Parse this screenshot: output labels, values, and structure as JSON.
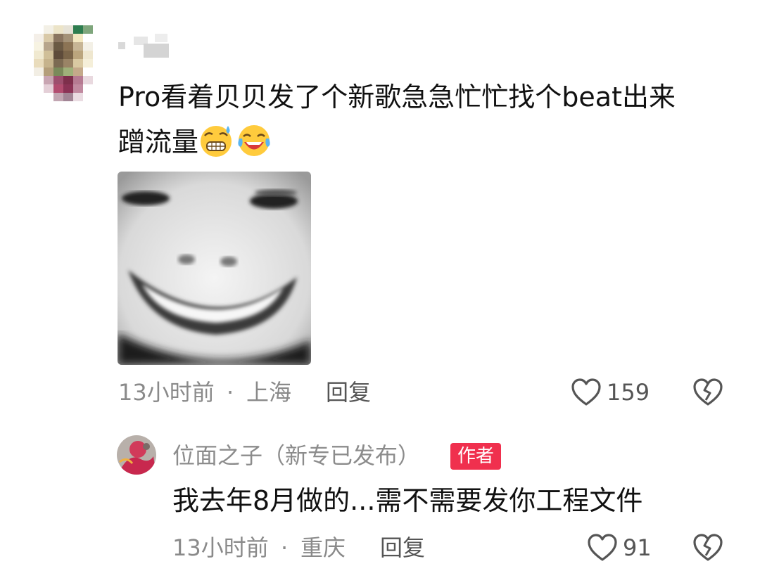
{
  "comment": {
    "avatar_icon": "pixelated-avatar",
    "username": "",
    "text_line1": "Pro看着贝贝发了个新歌急急忙忙找个beat出来",
    "text_line2": "蹭流量",
    "emojis": [
      "grinning-sweat-emoji",
      "tears-of-joy-emoji"
    ],
    "image": "smiling-face-meme",
    "time": "13小时前",
    "separator": "·",
    "location": "上海",
    "reply_label": "回复",
    "like_count": "159"
  },
  "reply": {
    "avatar_icon": "artist-avatar",
    "username": "位面之子（新专已发布）",
    "badge": "作者",
    "text": "我去年8月做的...需不需要发你工程文件",
    "time": "13小时前",
    "separator": "·",
    "location": "重庆",
    "reply_label": "回复",
    "like_count": "91"
  },
  "colors": {
    "badge_bg": "#f0304e",
    "meta_gray": "#8a8a8a",
    "text": "#111111"
  }
}
